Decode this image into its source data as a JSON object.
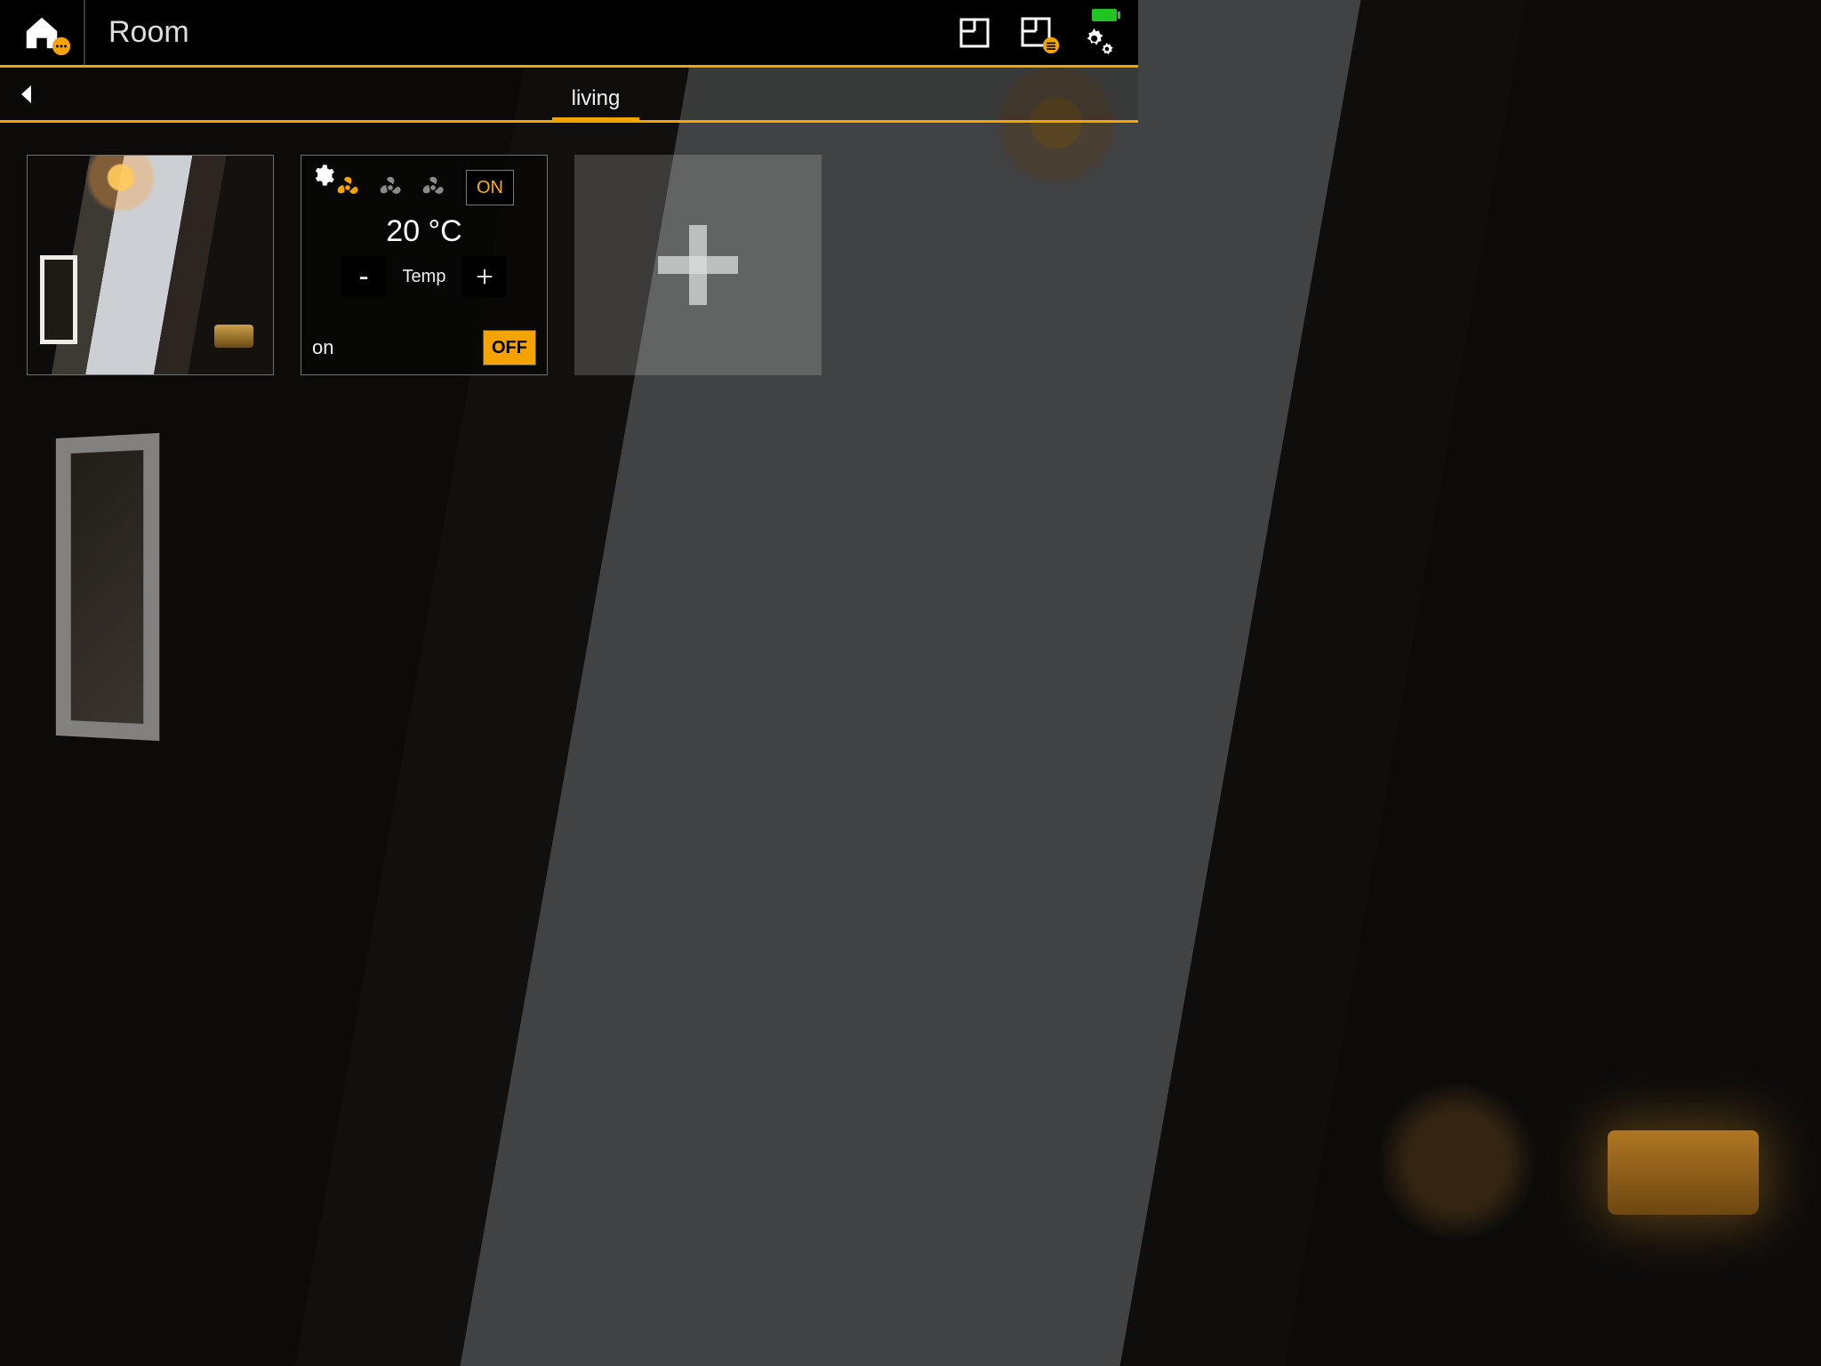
{
  "header": {
    "title": "Room"
  },
  "tabs": {
    "active": "living",
    "items": [
      "living"
    ]
  },
  "cards": {
    "ac": {
      "on_label": "ON",
      "off_label": "OFF",
      "temperature_display": "20 °C",
      "temp_label": "Temp",
      "status": "on",
      "fan_speed_selected": 1
    }
  },
  "colors": {
    "accent": "#f5a300"
  }
}
